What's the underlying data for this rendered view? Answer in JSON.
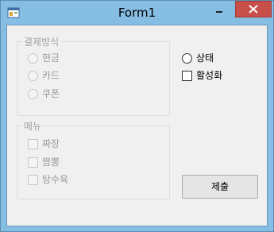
{
  "window": {
    "title": "Form1",
    "controls": {
      "minimize_icon": "minimize-icon",
      "maximize_icon": "maximize-icon",
      "close_icon": "close-icon",
      "close_color": "#c7504a"
    }
  },
  "payment_group": {
    "title": "결제방식",
    "enabled": false,
    "options": [
      {
        "label": "현금",
        "selected": false
      },
      {
        "label": "카드",
        "selected": false
      },
      {
        "label": "쿠폰",
        "selected": false
      }
    ]
  },
  "menu_group": {
    "title": "메뉴",
    "enabled": false,
    "items": [
      {
        "label": "짜장",
        "checked": false
      },
      {
        "label": "짬뽕",
        "checked": false
      },
      {
        "label": "탕수육",
        "checked": false
      }
    ]
  },
  "status_radio": {
    "label": "상태",
    "selected": false
  },
  "active_checkbox": {
    "label": "활성화",
    "checked": false
  },
  "submit_button": {
    "label": "제출"
  },
  "colors": {
    "frame": "#86bde2",
    "client": "#f0f0f0",
    "disabled_text": "#9a9a9a",
    "group_border": "#dcdcdc"
  }
}
